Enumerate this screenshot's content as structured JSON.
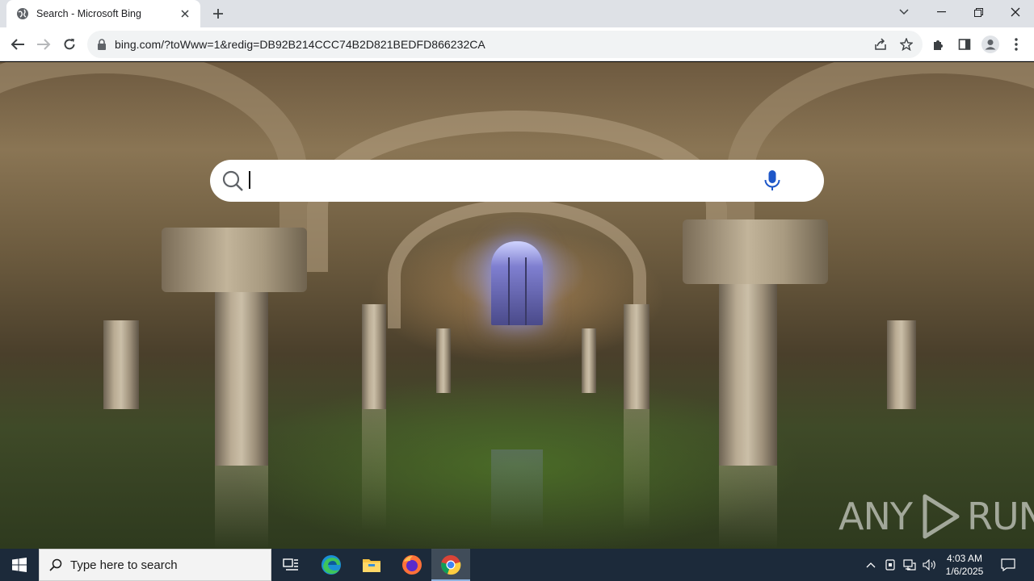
{
  "browser": {
    "tab": {
      "title": "Search - Microsoft Bing",
      "favicon": "globe-icon"
    },
    "new_tab_icon": "plus-icon",
    "window_controls": [
      "chevron-down-icon",
      "minimize-icon",
      "restore-icon",
      "close-icon"
    ],
    "address_bar": {
      "url": "bing.com/?toWww=1&redig=DB92B214CCC74B2D821BEDFD866232CA"
    },
    "nav_icons": [
      "back-arrow-icon",
      "forward-arrow-icon",
      "reload-icon"
    ],
    "toolbar_icons": [
      "share-icon",
      "bookmark-star-icon",
      "extensions-icon",
      "side-panel-icon",
      "profile-icon",
      "menu-icon"
    ]
  },
  "bing": {
    "search": {
      "value": "",
      "placeholder": ""
    },
    "background": "flooded crypt with columns and arches",
    "watermark_left": "ANY",
    "watermark_right": "RUN"
  },
  "taskbar": {
    "search_placeholder": "Type here to search",
    "apps": [
      "windows-start-icon",
      "task-view-icon",
      "edge-icon",
      "file-explorer-icon",
      "firefox-icon",
      "chrome-icon"
    ],
    "clock": {
      "time": "4:03 AM",
      "date": "1/6/2025"
    },
    "colors": {
      "taskbar": "#1c2a3a",
      "active_indicator": "#8fb4e0"
    }
  }
}
